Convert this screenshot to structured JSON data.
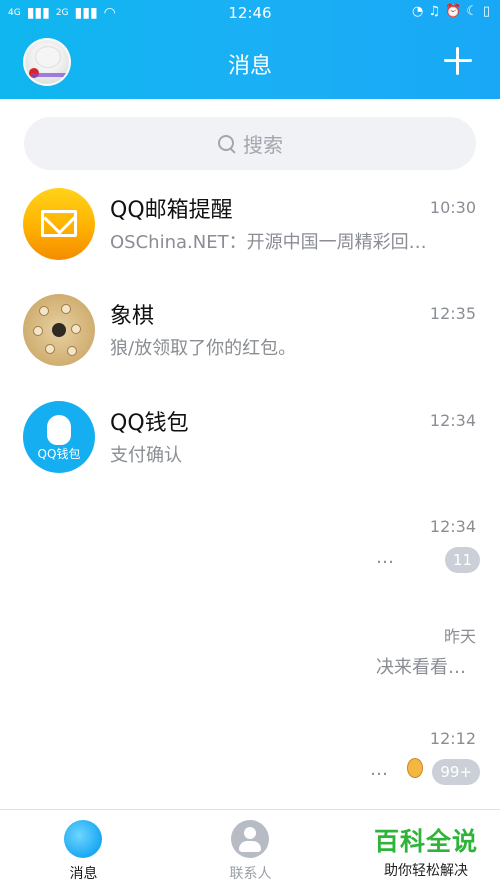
{
  "status_bar": {
    "signal_left": "4G",
    "signal_right": "2G",
    "time": "12:46"
  },
  "header": {
    "title": "消息",
    "add_icon": "plus-icon"
  },
  "search": {
    "placeholder": "搜索"
  },
  "conversations": [
    {
      "name": "QQ邮箱提醒",
      "time": "10:30",
      "message": "OSChina.NET：开源中国一周精彩回…",
      "avatar": "mail-icon"
    },
    {
      "name": "象棋",
      "time": "12:35",
      "message": "狼/放领取了你的红包。",
      "avatar": "chess-icon"
    },
    {
      "name": "QQ钱包",
      "time": "12:34",
      "message": "支付确认",
      "avatar": "wallet-icon",
      "avatar_label": "QQ钱包"
    },
    {
      "name": "",
      "time": "12:34",
      "message": "…",
      "badge": "11"
    },
    {
      "name": "",
      "time": "昨天",
      "message": "决来看看…"
    },
    {
      "name": "",
      "time": "12:12",
      "message": "…",
      "badge": "99+"
    }
  ],
  "bottom_nav": {
    "messages": "消息",
    "contacts": "联系人"
  },
  "watermark": {
    "title": "百科全说",
    "subtitle": "助你轻松解决"
  },
  "colors": {
    "header_blue": "#19b0f3",
    "badge_gray": "#cbd0d8",
    "watermark_green": "#2fb43a"
  }
}
